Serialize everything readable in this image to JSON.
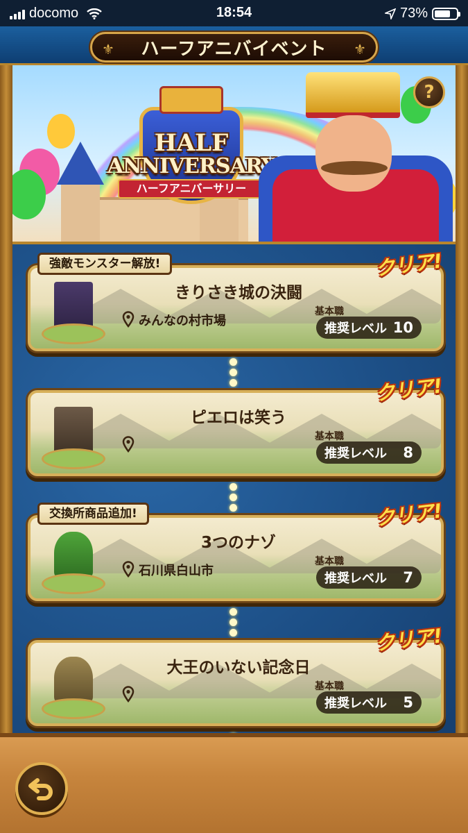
{
  "status_bar": {
    "carrier": "docomo",
    "time": "18:54",
    "battery_percent": "73%",
    "battery_level": 0.73
  },
  "header": {
    "title": "ハーフアニバイベント"
  },
  "banner": {
    "emblem_line1": "HALF",
    "emblem_line2": "ANNIVERSARY",
    "emblem_subtitle": "ハーフアニバーサリー",
    "help_label": "?"
  },
  "quests": [
    {
      "tag": "強敵モンスター解放!",
      "name": "きりさき城の決闘",
      "location": "みんなの村市場",
      "job_label": "基本職",
      "level_label": "推奨レベル",
      "level": "10",
      "status": "クリア!",
      "thumb": "castle"
    },
    {
      "tag": "",
      "name": "ピエロは笑う",
      "location": "",
      "job_label": "基本職",
      "level_label": "推奨レベル",
      "level": "8",
      "status": "クリア!",
      "thumb": "tower"
    },
    {
      "tag": "交換所商品追加!",
      "name": "3つのナゾ",
      "location": "石川県白山市",
      "job_label": "基本職",
      "level_label": "推奨レベル",
      "level": "7",
      "status": "クリア!",
      "thumb": "forest"
    },
    {
      "tag": "",
      "name": "大王のいない記念日",
      "location": "",
      "job_label": "基本職",
      "level_label": "推奨レベル",
      "level": "5",
      "status": "クリア!",
      "thumb": "cave"
    }
  ],
  "colors": {
    "accent_gold": "#d7b05a",
    "clear_yellow": "#ffe04a",
    "clear_outline": "#b9340e",
    "panel_blue": "#1c4e85"
  },
  "icons": {
    "help": "question-icon",
    "location": "map-pin-icon",
    "back": "return-arrow-icon"
  }
}
